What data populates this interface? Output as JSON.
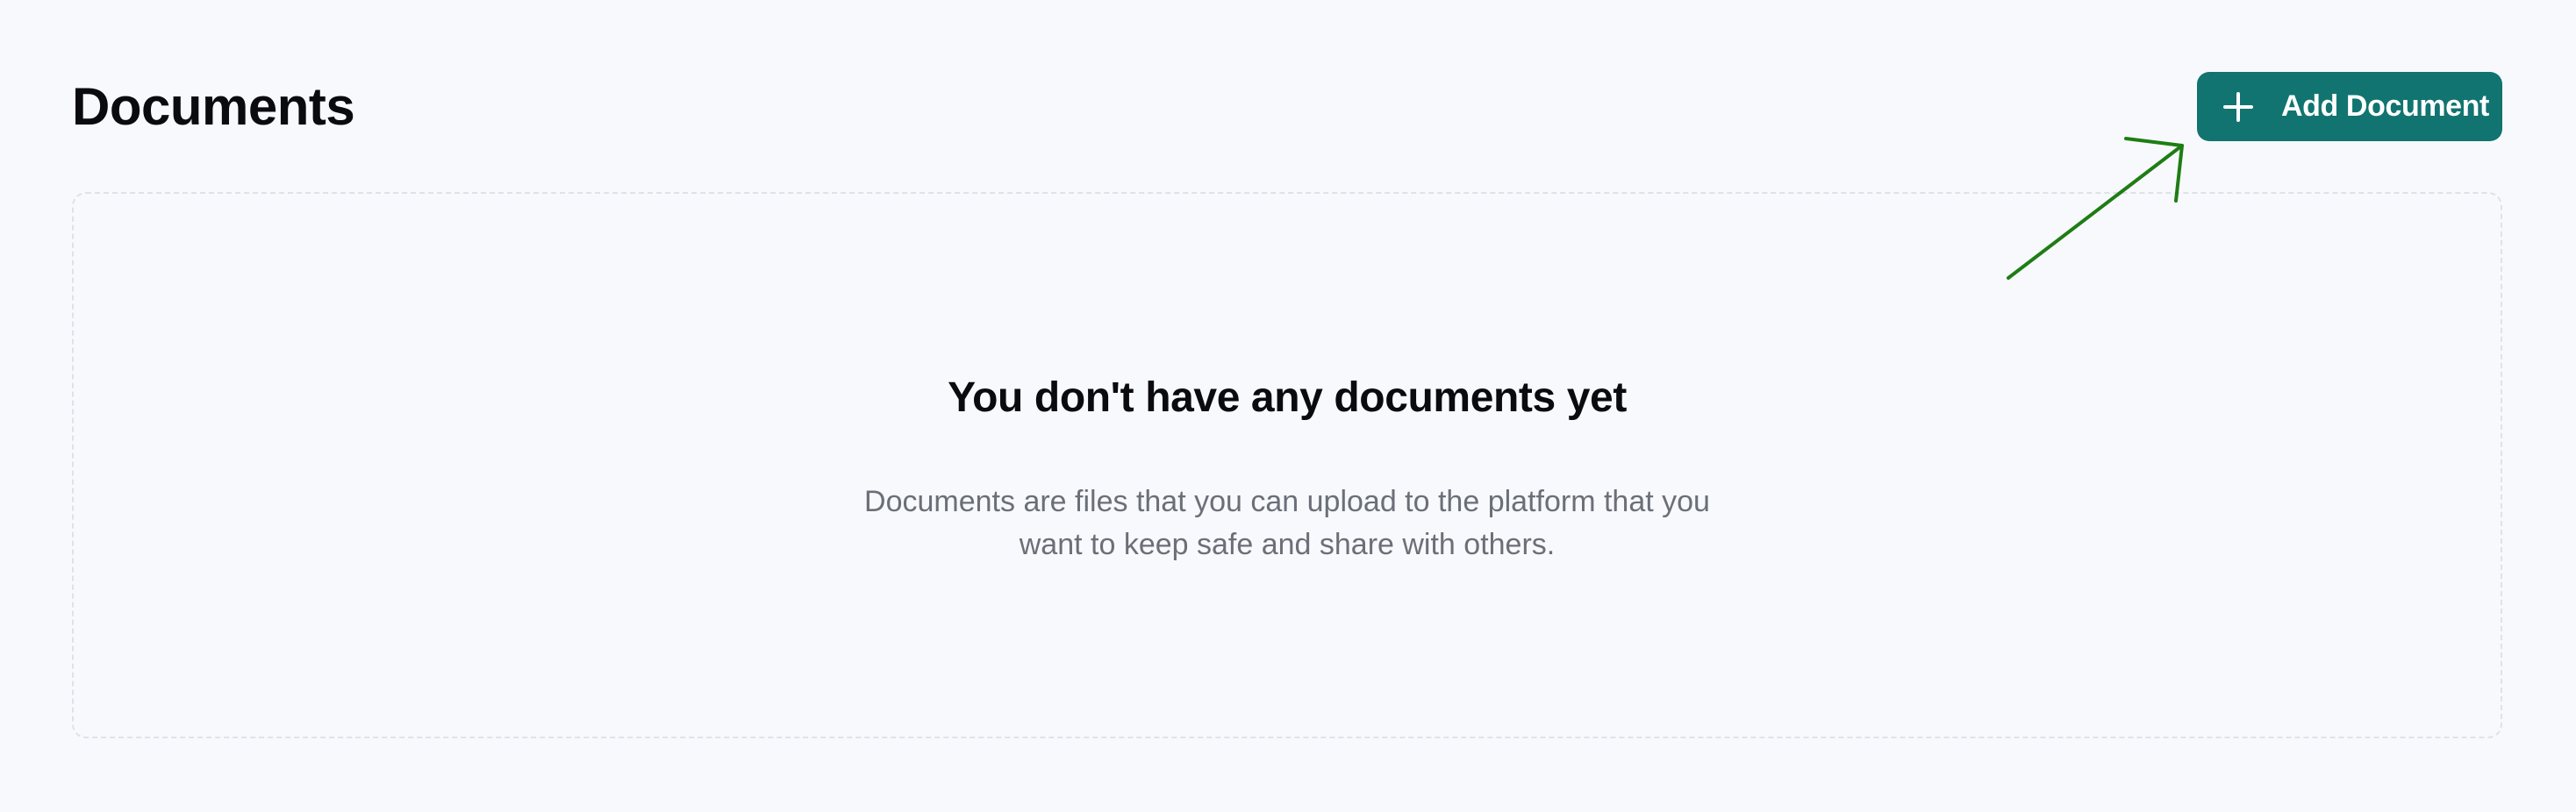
{
  "header": {
    "title": "Documents",
    "add_button": {
      "label": "Add Document",
      "icon": "plus-icon"
    }
  },
  "empty_state": {
    "heading": "You don't have any documents yet",
    "description_line1": "Documents are files that you can upload to the platform that you",
    "description_line2": "want to keep safe and share with others."
  },
  "colors": {
    "background": "#f8f9fc",
    "accent": "#117470",
    "annotation_arrow": "#1e7d14"
  }
}
